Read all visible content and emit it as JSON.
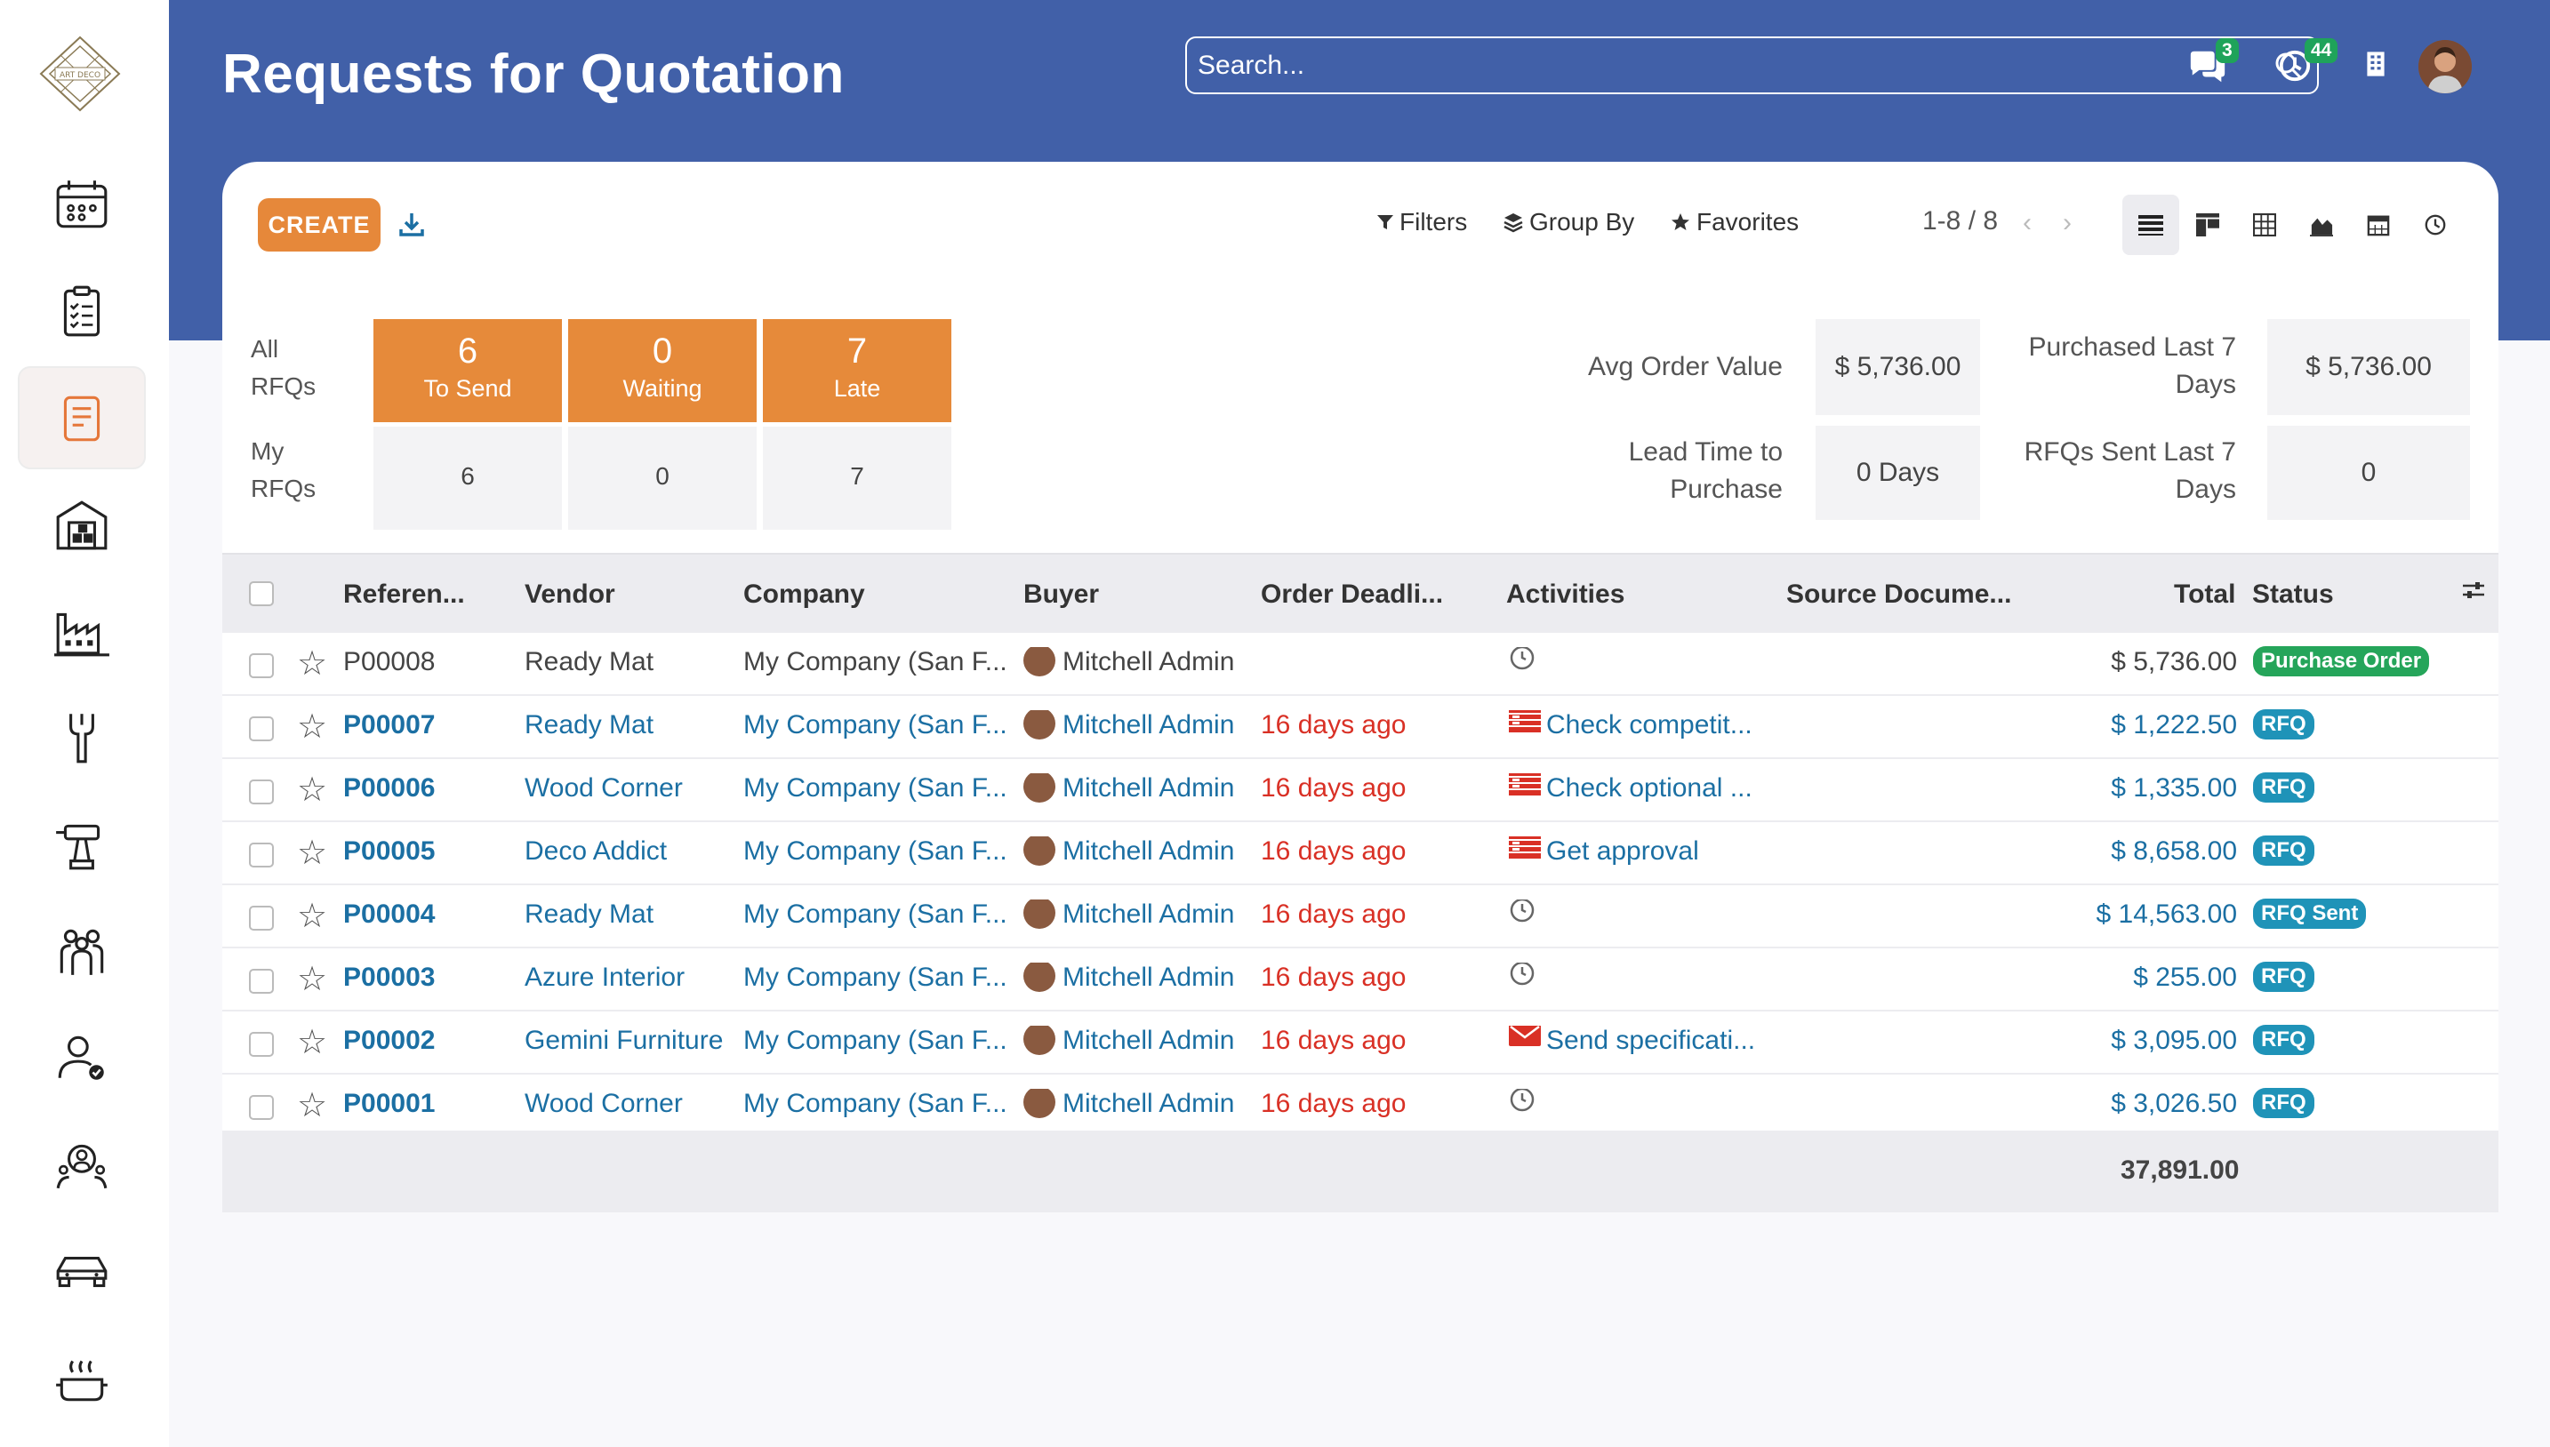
{
  "app": {
    "title": "Requests for Quotation",
    "logo_text": "ART DECO"
  },
  "search": {
    "placeholder": "Search..."
  },
  "header": {
    "messages_count": "3",
    "activities_count": "44"
  },
  "sidebar": {
    "items": [
      {
        "name": "calendar"
      },
      {
        "name": "tasks"
      },
      {
        "name": "purchase",
        "active": true
      },
      {
        "name": "warehouse"
      },
      {
        "name": "manufacturing"
      },
      {
        "name": "tools"
      },
      {
        "name": "drill"
      },
      {
        "name": "employees"
      },
      {
        "name": "user-check"
      },
      {
        "name": "recruitment"
      },
      {
        "name": "fleet"
      },
      {
        "name": "kitchen"
      }
    ]
  },
  "toolbar": {
    "create_label": "CREATE",
    "filters_label": "Filters",
    "groupby_label": "Group By",
    "favorites_label": "Favorites",
    "pager": "1-8 / 8"
  },
  "dashboard": {
    "all_label": "All\nRFQs",
    "my_label": "My\nRFQs",
    "all": [
      {
        "num": "6",
        "label": "To Send"
      },
      {
        "num": "0",
        "label": "Waiting"
      },
      {
        "num": "7",
        "label": "Late"
      }
    ],
    "my": [
      "6",
      "0",
      "7"
    ],
    "stats": [
      {
        "label": "Avg Order Value",
        "value": "$ 5,736.00"
      },
      {
        "label": "Purchased Last 7 Days",
        "value": "$ 5,736.00"
      },
      {
        "label": "Lead Time to Purchase",
        "value": "0  Days"
      },
      {
        "label": "RFQs Sent Last 7 Days",
        "value": "0"
      }
    ]
  },
  "table": {
    "columns": [
      "Referen...",
      "Vendor",
      "Company",
      "Buyer",
      "Order Deadli...",
      "Activities",
      "Source Docume...",
      "Total",
      "Status"
    ],
    "rows": [
      {
        "ref": "P00008",
        "vendor": "Ready Mat",
        "company": "My Company (San F...",
        "buyer": "Mitchell Admin",
        "deadline": "",
        "activity": "",
        "activity_icon": "clock-icon",
        "total": "$ 5,736.00",
        "status": "Purchase Order",
        "status_color": "#25a55a",
        "style": "dark"
      },
      {
        "ref": "P00007",
        "vendor": "Ready Mat",
        "company": "My Company (San F...",
        "buyer": "Mitchell Admin",
        "deadline": "16 days ago",
        "activity": "Check competit...",
        "activity_icon": "list-icon",
        "total": "$ 1,222.50",
        "status": "RFQ",
        "status_color": "#1f93b8",
        "style": "blue"
      },
      {
        "ref": "P00006",
        "vendor": "Wood Corner",
        "company": "My Company (San F...",
        "buyer": "Mitchell Admin",
        "deadline": "16 days ago",
        "activity": "Check optional ...",
        "activity_icon": "list-icon",
        "total": "$ 1,335.00",
        "status": "RFQ",
        "status_color": "#1f93b8",
        "style": "blue"
      },
      {
        "ref": "P00005",
        "vendor": "Deco Addict",
        "company": "My Company (San F...",
        "buyer": "Mitchell Admin",
        "deadline": "16 days ago",
        "activity": "Get approval",
        "activity_icon": "list-icon",
        "total": "$ 8,658.00",
        "status": "RFQ",
        "status_color": "#1f93b8",
        "style": "blue"
      },
      {
        "ref": "P00004",
        "vendor": "Ready Mat",
        "company": "My Company (San F...",
        "buyer": "Mitchell Admin",
        "deadline": "16 days ago",
        "activity": "",
        "activity_icon": "clock-icon",
        "total": "$ 14,563.00",
        "status": "RFQ Sent",
        "status_color": "#1f93b8",
        "style": "blue"
      },
      {
        "ref": "P00003",
        "vendor": "Azure Interior",
        "company": "My Company (San F...",
        "buyer": "Mitchell Admin",
        "deadline": "16 days ago",
        "activity": "",
        "activity_icon": "clock-icon",
        "total": "$ 255.00",
        "status": "RFQ",
        "status_color": "#1f93b8",
        "style": "blue"
      },
      {
        "ref": "P00002",
        "vendor": "Gemini Furniture",
        "company": "My Company (San F...",
        "buyer": "Mitchell Admin",
        "deadline": "16 days ago",
        "activity": "Send specificati...",
        "activity_icon": "envelope-icon",
        "total": "$ 3,095.00",
        "status": "RFQ",
        "status_color": "#1f93b8",
        "style": "blue"
      },
      {
        "ref": "P00001",
        "vendor": "Wood Corner",
        "company": "My Company (San F...",
        "buyer": "Mitchell Admin",
        "deadline": "16 days ago",
        "activity": "",
        "activity_icon": "clock-icon",
        "total": "$ 3,026.50",
        "status": "RFQ",
        "status_color": "#1f93b8",
        "style": "blue"
      }
    ],
    "sum_total": "37,891.00"
  }
}
